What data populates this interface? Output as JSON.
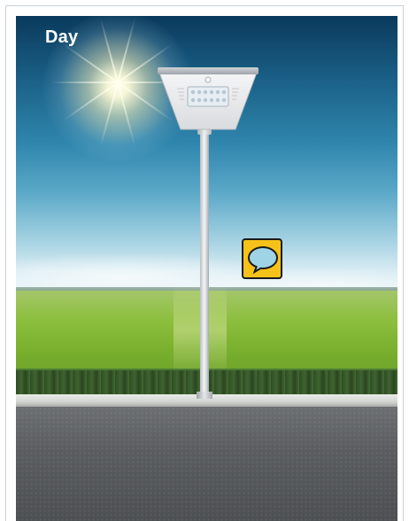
{
  "scene": {
    "label": "Day",
    "description_icon": "speech-bubble-icon",
    "colors": {
      "label": "#ffffff",
      "comment_button_bg": "#f6c21a",
      "comment_bubble": "#9fd4e6"
    }
  }
}
